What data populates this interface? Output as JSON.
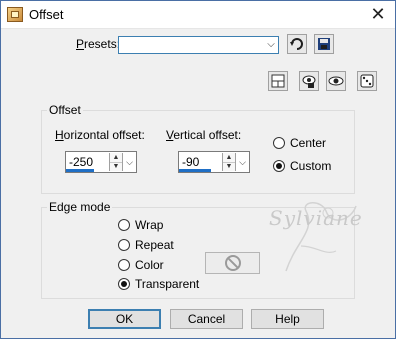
{
  "window": {
    "title": "Offset",
    "close_glyph": "✕"
  },
  "presets": {
    "label": "Presets:",
    "value": "",
    "dropdown_glyph": "⌵"
  },
  "toolbar": {
    "icons": [
      "reset-arrow-icon",
      "save-disk-icon",
      "layout-icon",
      "eye-hold-icon",
      "eye-icon",
      "dice-icon"
    ]
  },
  "offset_group": {
    "title": "Offset",
    "horizontal": {
      "label": "Horizontal offset:",
      "value": "-250"
    },
    "vertical": {
      "label": "Vertical offset:",
      "value": "-90"
    },
    "options": [
      {
        "label": "Center",
        "selected": false
      },
      {
        "label": "Custom",
        "selected": true
      }
    ]
  },
  "edge_mode": {
    "title": "Edge mode",
    "options": [
      {
        "label": "Wrap",
        "selected": false
      },
      {
        "label": "Repeat",
        "selected": false
      },
      {
        "label": "Color",
        "selected": false
      },
      {
        "label": "Transparent",
        "selected": true
      }
    ]
  },
  "watermark": {
    "text": "Sylviane"
  },
  "buttons": {
    "ok": "OK",
    "cancel": "Cancel",
    "help": "Help"
  }
}
